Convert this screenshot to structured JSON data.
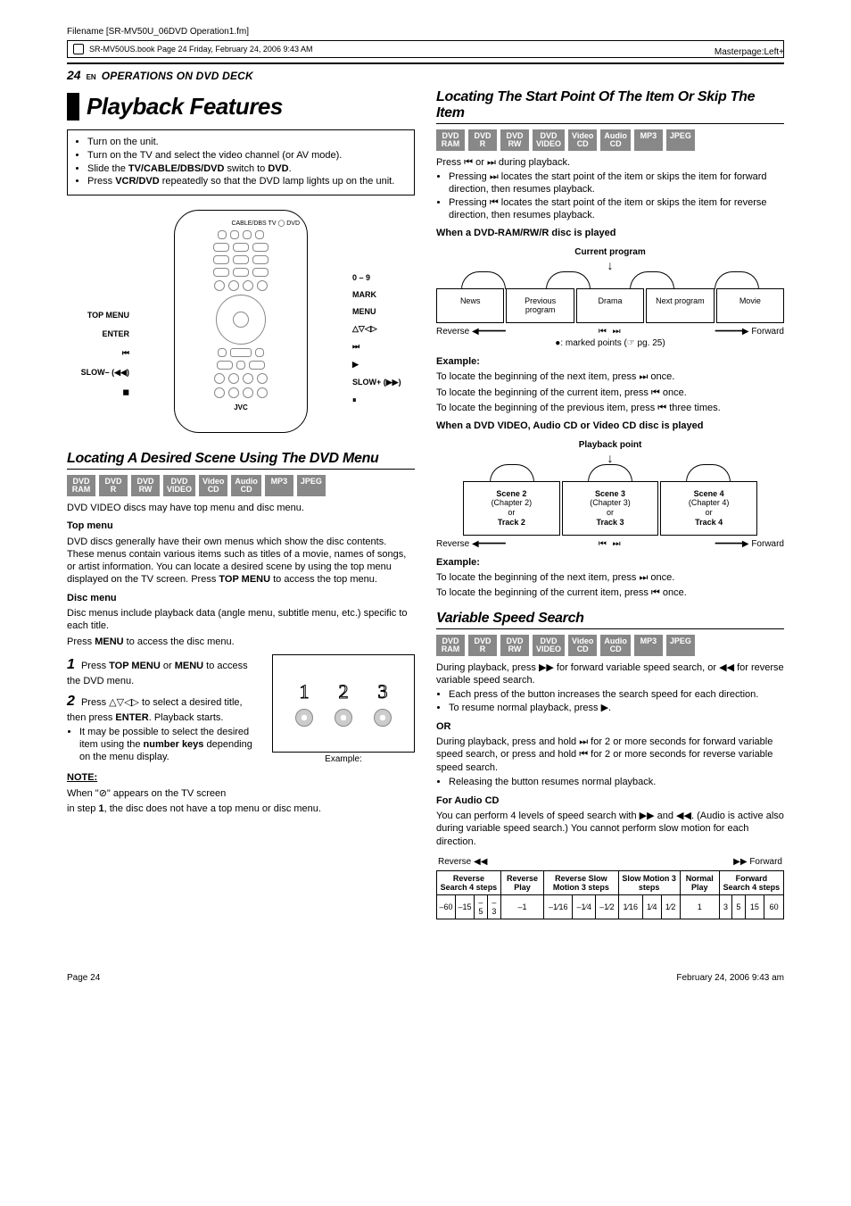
{
  "meta": {
    "filename": "Filename [SR-MV50U_06DVD Operation1.fm]",
    "bookline": "SR-MV50US.book  Page 24  Friday, February 24, 2006  9:43 AM",
    "masterpage": "Masterpage:Left+"
  },
  "header": {
    "pagenum": "24",
    "en": "EN",
    "section": "OPERATIONS ON DVD DECK"
  },
  "title": "Playback Features",
  "intro": {
    "b1": "Turn on the unit.",
    "b2": "Turn on the TV and select the video channel (or AV mode).",
    "b3_pre": "Slide the ",
    "b3_b1": "TV/CABLE/DBS/DVD",
    "b3_mid": " switch to ",
    "b3_b2": "DVD",
    "b3_post": ".",
    "b4_pre": "Press ",
    "b4_b": "VCR/DVD",
    "b4_post": " repeatedly so that the DVD lamp lights up on the unit."
  },
  "remote": {
    "top_right": "CABLE/DBS  TV  ◯ DVD",
    "r1_l": "TOP MENU",
    "r1_r": "0 – 9",
    "r2_r": "MARK",
    "r3_r": "MENU",
    "r4_l": "ENTER",
    "r4_r": "△▽◁▷",
    "r5_l": "⏮",
    "r5_r": "⏭",
    "r6_l": "SLOW– (◀◀)",
    "r6_r": "▶",
    "r6b_r": "SLOW+ (▶▶)",
    "r7_l": "◼",
    "r7_r": "⏸",
    "brand": "JVC"
  },
  "left": {
    "h_locating_menu": "Locating A Desired Scene Using The DVD Menu",
    "chips": [
      "DVD\nRAM",
      "DVD\nR",
      "DVD\nRW",
      "DVD\nVIDEO",
      "Video\nCD",
      "Audio\nCD",
      "MP3",
      "JPEG"
    ],
    "p_intro": "DVD VIDEO discs may have top menu and disc menu.",
    "h_top": "Top menu",
    "p_top_pre": "DVD discs generally have their own menus which show the disc contents. These menus contain various items such as titles of a movie, names of songs, or artist information. You can locate a desired scene by using the top menu displayed on the TV screen. Press ",
    "p_top_b": "TOP MENU",
    "p_top_post": " to access the top menu.",
    "h_disc": "Disc menu",
    "p_disc": "Disc menus include playback data (angle menu, subtitle menu, etc.) specific to each title.",
    "p_disc2_pre": "Press ",
    "p_disc2_b": "MENU",
    "p_disc2_post": " to access the disc menu.",
    "s1_pre": "Press ",
    "s1_b1": "TOP MENU",
    "s1_mid": " or ",
    "s1_b2": "MENU",
    "s1_post": " to access the DVD menu.",
    "s2_pre": "Press ",
    "s2_sym": "△▽◁▷",
    "s2_mid": " to select a desired title, then press ",
    "s2_b": "ENTER",
    "s2_post": ". Playback starts.",
    "s2_bullet_pre": "It may be possible to select the desired item using the ",
    "s2_bullet_b": "number keys",
    "s2_bullet_post": " depending on the menu display.",
    "example_label": "Example:",
    "note_hd": "NOTE:",
    "note_l1": "When \"⊘\" appears on the TV screen",
    "note_l2_pre": "in step ",
    "note_l2_b": "1",
    "note_l2_post": ", the disc does not have a top menu or disc menu."
  },
  "right": {
    "h_skip": "Locating The Start Point Of The Item Or Skip The Item",
    "p_skip_intro": "Press ⏮ or ⏭ during playback.",
    "b_skip1": "Pressing ⏭ locates the start point of the item or skips the item for forward direction, then resumes playback.",
    "b_skip2": "Pressing ⏮ locates the start point of the item or skips the item for reverse direction, then resumes playback.",
    "h_when_ram": "When a DVD-RAM/RW/R disc is played",
    "cur_prog": "Current program",
    "prog_cells": [
      "News",
      "Previous\nprogram",
      "Drama",
      "Next\nprogram",
      "Movie"
    ],
    "reverse": "Reverse",
    "forward": "Forward",
    "mid_icons": "⏮      ⏭",
    "marked_pre": "●: marked points (☞ pg. 25)",
    "ex_hd": "Example:",
    "ex_ram1": "To locate the beginning of the next item, press ⏭ once.",
    "ex_ram2": "To locate the beginning of the current item, press ⏮ once.",
    "ex_ram3": "To locate the beginning of the previous item, press ⏮ three times.",
    "h_when_video": "When a DVD VIDEO, Audio CD or Video CD disc is played",
    "playback_pt": "Playback point",
    "scene_cells": [
      {
        "a": "Scene 2",
        "b": "(Chapter 2)",
        "c": "or",
        "d": "Track 2"
      },
      {
        "a": "Scene 3",
        "b": "(Chapter 3)",
        "c": "or",
        "d": "Track 3"
      },
      {
        "a": "Scene 4",
        "b": "(Chapter 4)",
        "c": "or",
        "d": "Track 4"
      }
    ],
    "ex_v1": "To locate the beginning of the next item, press ⏭ once.",
    "ex_v2": "To locate the beginning of the current item, press ⏮ once.",
    "h_varspeed": "Variable Speed Search",
    "vs_p1": "During playback, press ▶▶ for forward variable speed search, or ◀◀ for reverse variable speed search.",
    "vs_b1": "Each press of the button increases the search speed for each direction.",
    "vs_b2": "To resume normal playback, press ▶.",
    "or": "OR",
    "vs_p2": "During playback, press and hold ⏭ for 2 or more seconds for forward variable speed search, or press and hold ⏮ for 2 or more seconds for reverse variable speed search.",
    "vs_b3": "Releasing the button resumes normal playback.",
    "h_audiocd": "For Audio CD",
    "vs_p3": "You can perform 4 levels of speed search with ▶▶ and ◀◀. (Audio is active also during variable speed search.) You cannot perform slow motion for each direction.",
    "tbl_rev": "Reverse ◀◀",
    "tbl_fwd": "▶▶ Forward",
    "tbl_headers": [
      "Reverse Search\n4 steps",
      "Reverse\nPlay",
      "Reverse\nSlow Motion\n3 steps",
      "Slow Motion\n3 steps",
      "Normal\nPlay",
      "Forward Search\n4 steps"
    ],
    "tbl_vals": [
      "–60",
      "–15",
      "–5",
      "–3",
      "–1",
      "–1⁄16",
      "–1⁄4",
      "–1⁄2",
      "1⁄16",
      "1⁄4",
      "1⁄2",
      "1",
      "3",
      "5",
      "15",
      "60"
    ]
  },
  "footer": {
    "left": "Page 24",
    "right": "February 24, 2006  9:43 am"
  }
}
